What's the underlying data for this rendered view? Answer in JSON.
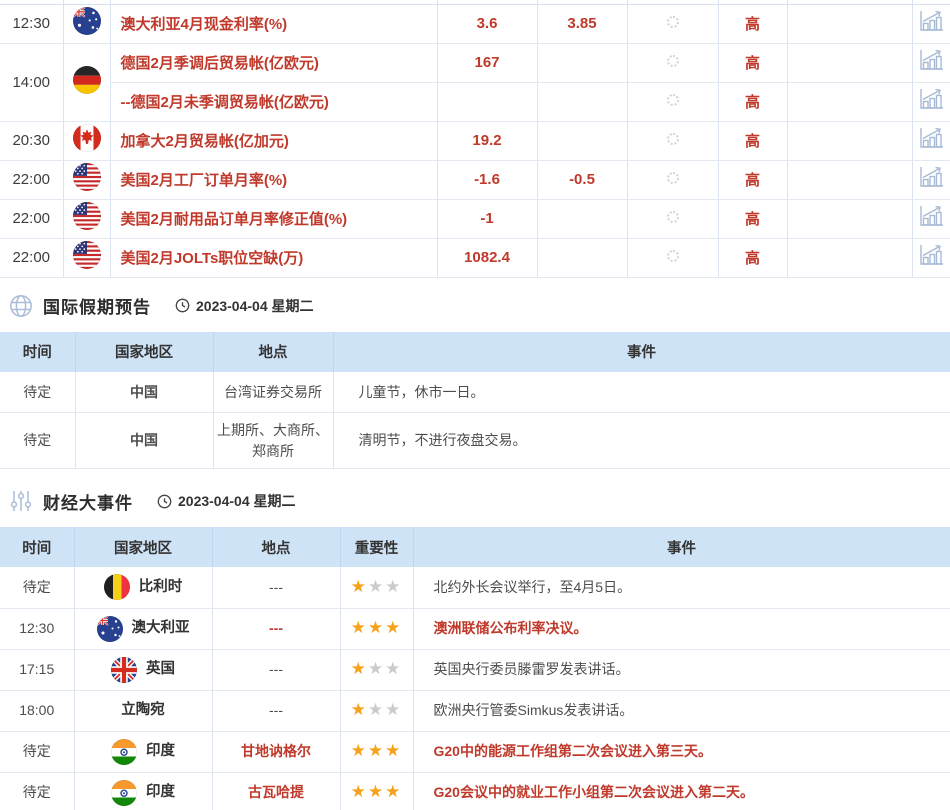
{
  "colors": {
    "accent_red": "#c0392b",
    "table_header_bg": "#cfe3f7",
    "star_gold": "#f7a21b",
    "star_gray": "#cbcbcb",
    "icon_blue_gray": "#aabdd9",
    "border_blue": "#dbe4f0"
  },
  "economic_table": {
    "rows": [
      {
        "time": "12:30",
        "flag": "australia",
        "title": "澳大利亚4月现金利率(%)",
        "previous": "3.6",
        "forecast": "3.85",
        "importance": "高"
      },
      {
        "time": "14:00",
        "flag": "germany",
        "rowspan": 2,
        "title": "德国2月季调后贸易帐(亿欧元)",
        "previous": "167",
        "forecast": "",
        "importance": "高"
      },
      {
        "time": null,
        "flag": null,
        "title": "--德国2月未季调贸易帐(亿欧元)",
        "previous": "",
        "forecast": "",
        "importance": "高"
      },
      {
        "time": "20:30",
        "flag": "canada",
        "title": "加拿大2月贸易帐(亿加元)",
        "previous": "19.2",
        "forecast": "",
        "importance": "高"
      },
      {
        "time": "22:00",
        "flag": "usa",
        "title": "美国2月工厂订单月率(%)",
        "previous": "-1.6",
        "forecast": "-0.5",
        "importance": "高"
      },
      {
        "time": "22:00",
        "flag": "usa",
        "title": "美国2月耐用品订单月率修正值(%)",
        "previous": "-1",
        "forecast": "",
        "importance": "高"
      },
      {
        "time": "22:00",
        "flag": "usa",
        "title": "美国2月JOLTs职位空缺(万)",
        "previous": "1082.4",
        "forecast": "",
        "importance": "高"
      }
    ]
  },
  "holiday_section": {
    "title": "国际假期预告",
    "date": "2023-04-04 星期二",
    "headers": [
      "时间",
      "国家地区",
      "地点",
      "事件"
    ],
    "rows": [
      {
        "time": "待定",
        "country": "中国",
        "location": "台湾证券交易所",
        "event": "儿童节，休市一日。"
      },
      {
        "time": "待定",
        "country": "中国",
        "location": "上期所、大商所、郑商所",
        "event": "清明节，不进行夜盘交易。"
      }
    ]
  },
  "events_section": {
    "title": "财经大事件",
    "date": "2023-04-04 星期二",
    "headers": [
      "时间",
      "国家地区",
      "地点",
      "重要性",
      "事件"
    ],
    "rows": [
      {
        "time": "待定",
        "flag": "belgium",
        "country": "比利时",
        "location": "---",
        "stars": 1,
        "event": "北约外长会议举行，至4月5日。",
        "highlight": false
      },
      {
        "time": "12:30",
        "flag": "australia",
        "country": "澳大利亚",
        "location": "---",
        "stars": 3,
        "event": "澳洲联储公布利率决议。",
        "highlight": true
      },
      {
        "time": "17:15",
        "flag": "uk",
        "country": "英国",
        "location": "---",
        "stars": 1,
        "event": "英国央行委员滕雷罗发表讲话。",
        "highlight": false
      },
      {
        "time": "18:00",
        "flag": null,
        "country": "立陶宛",
        "location": "---",
        "stars": 1,
        "event": "欧洲央行管委Simkus发表讲话。",
        "highlight": false
      },
      {
        "time": "待定",
        "flag": "india",
        "country": "印度",
        "location": "甘地讷格尔",
        "stars": 3,
        "event": "G20中的能源工作组第二次会议进入第三天。",
        "highlight": true
      },
      {
        "time": "待定",
        "flag": "india",
        "country": "印度",
        "location": "古瓦哈提",
        "stars": 3,
        "event": "G20会议中的就业工作小组第二次会议进入第二天。",
        "highlight": true
      }
    ]
  }
}
